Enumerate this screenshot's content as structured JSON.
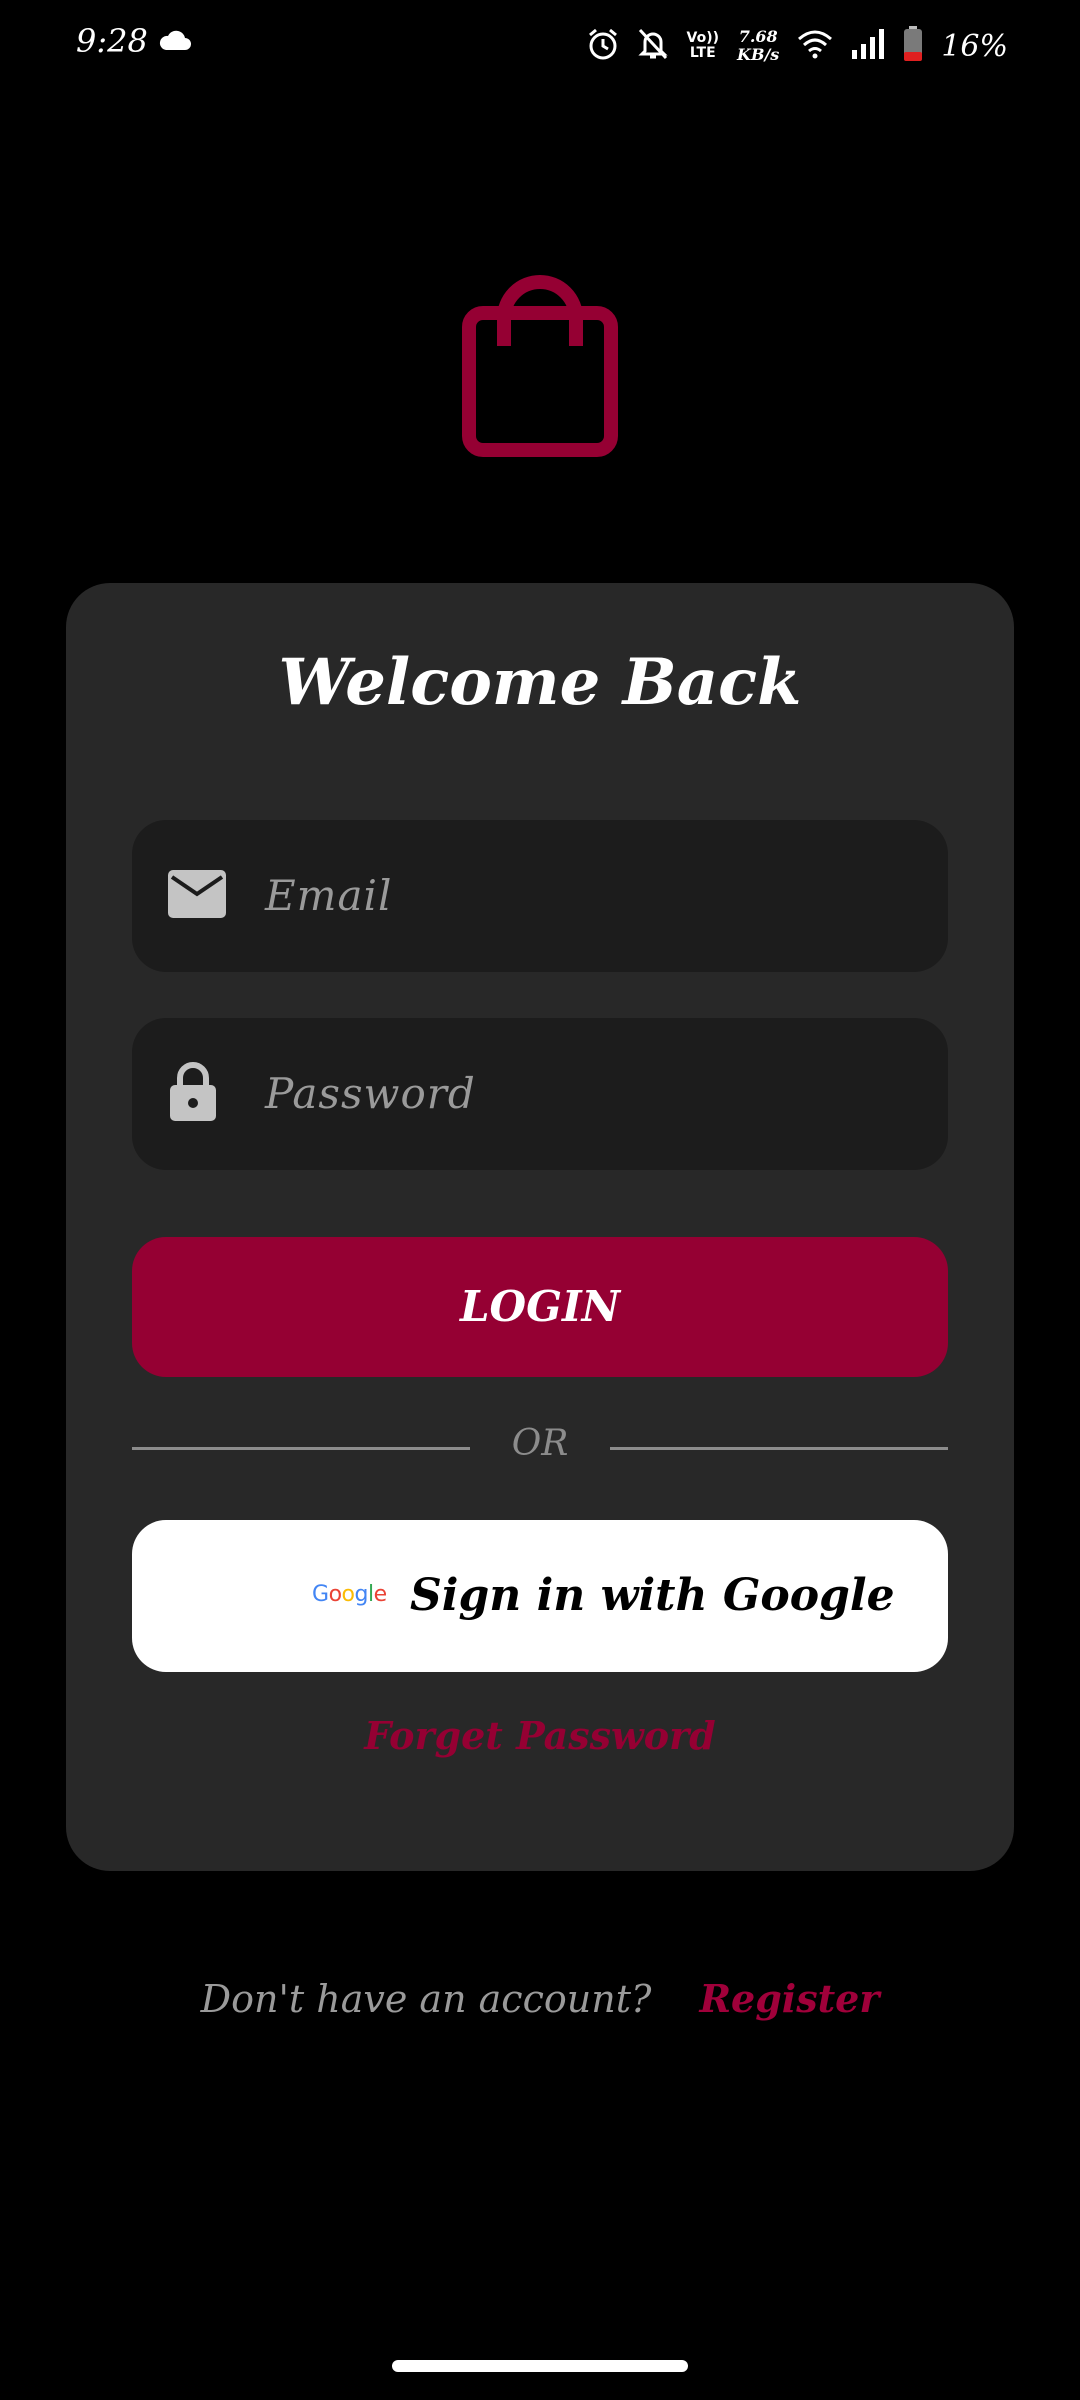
{
  "status_bar": {
    "time": "9:28",
    "net_speed_value": "7.68",
    "net_speed_unit": "KB/s",
    "volte_top": "Vo))",
    "volte_bottom": "LTE",
    "battery": "16%"
  },
  "icons": {
    "logo": "shopping-bag-icon",
    "email": "mail-icon",
    "password": "lock-icon"
  },
  "colors": {
    "accent": "#950033",
    "card": "#282828",
    "field": "#1c1c1c"
  },
  "card": {
    "title": "Welcome Back",
    "email_placeholder": "Email",
    "password_placeholder": "Password",
    "login_label": "LOGIN",
    "or_label": "OR",
    "google_logo": "Google",
    "google_label": "Sign in with Google",
    "forget_label": "Forget Password"
  },
  "footer": {
    "question": "Don't have an account?",
    "register_label": "Register"
  }
}
